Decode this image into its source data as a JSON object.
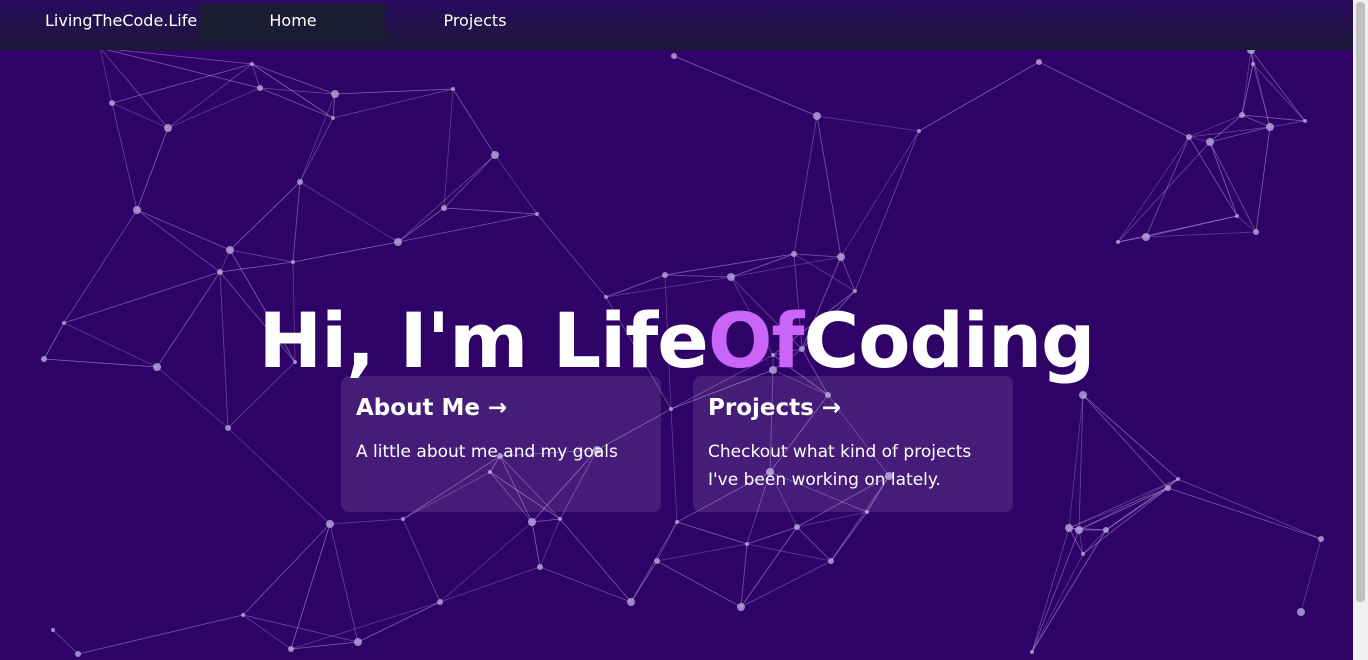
{
  "navbar": {
    "brand": "LivingTheCode.Life",
    "items": [
      {
        "label": "Home",
        "active": true
      },
      {
        "label": "Projects",
        "active": false
      }
    ]
  },
  "hero": {
    "prefix": "Hi, I'm Life",
    "accent": "Of",
    "suffix": "Coding"
  },
  "cards": [
    {
      "title": "About Me",
      "arrow": "→",
      "description": "A little about me and my goals"
    },
    {
      "title": "Projects",
      "arrow": "→",
      "description": "Checkout what kind of projects I've been working on lately."
    }
  ],
  "theme": {
    "background": "#2f0268",
    "accent": "#c966f7",
    "navbar": "#1b1836",
    "particle": "#b9a8e0"
  }
}
